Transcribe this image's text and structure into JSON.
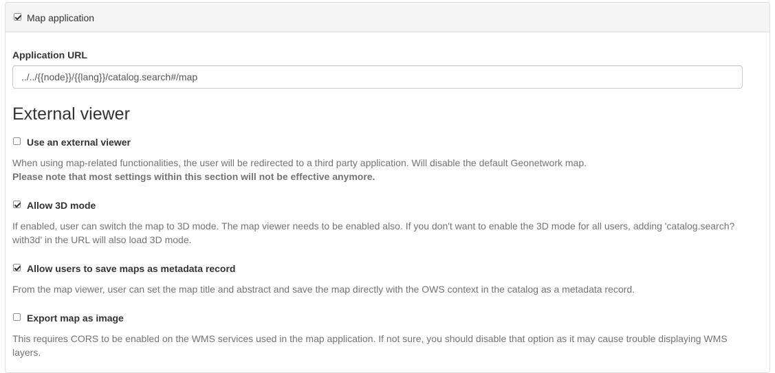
{
  "panel": {
    "title": "Map application",
    "title_checked": true
  },
  "application_url": {
    "label": "Application URL",
    "value": "../../{{node}}/{{lang}}/catalog.search#/map"
  },
  "external_viewer": {
    "heading": "External viewer",
    "options": [
      {
        "label": "Use an external viewer",
        "checked": false,
        "help": "When using map-related functionalities, the user will be redirected to a third party application. Will disable the default Geonetwork map.",
        "note": "Please note that most settings within this section will not be effective anymore."
      },
      {
        "label": "Allow 3D mode",
        "checked": true,
        "help_line1": "If enabled, user can switch the map to 3D mode. The map viewer needs to be enabled also. If you don't want to enable the 3D mode for all users, adding 'catalog.search?",
        "help_line2": "with3d' in the URL will also load 3D mode."
      },
      {
        "label": "Allow users to save maps as metadata record",
        "checked": true,
        "help": "From the map viewer, user can set the map title and abstract and save the map directly with the OWS context in the catalog as a metadata record."
      },
      {
        "label": "Export map as image",
        "checked": false,
        "help_line1": "This requires CORS to be enabled on the WMS services used in the map application. If not sure, you should disable that option as it may cause trouble displaying WMS",
        "help_line2": "layers."
      }
    ]
  }
}
